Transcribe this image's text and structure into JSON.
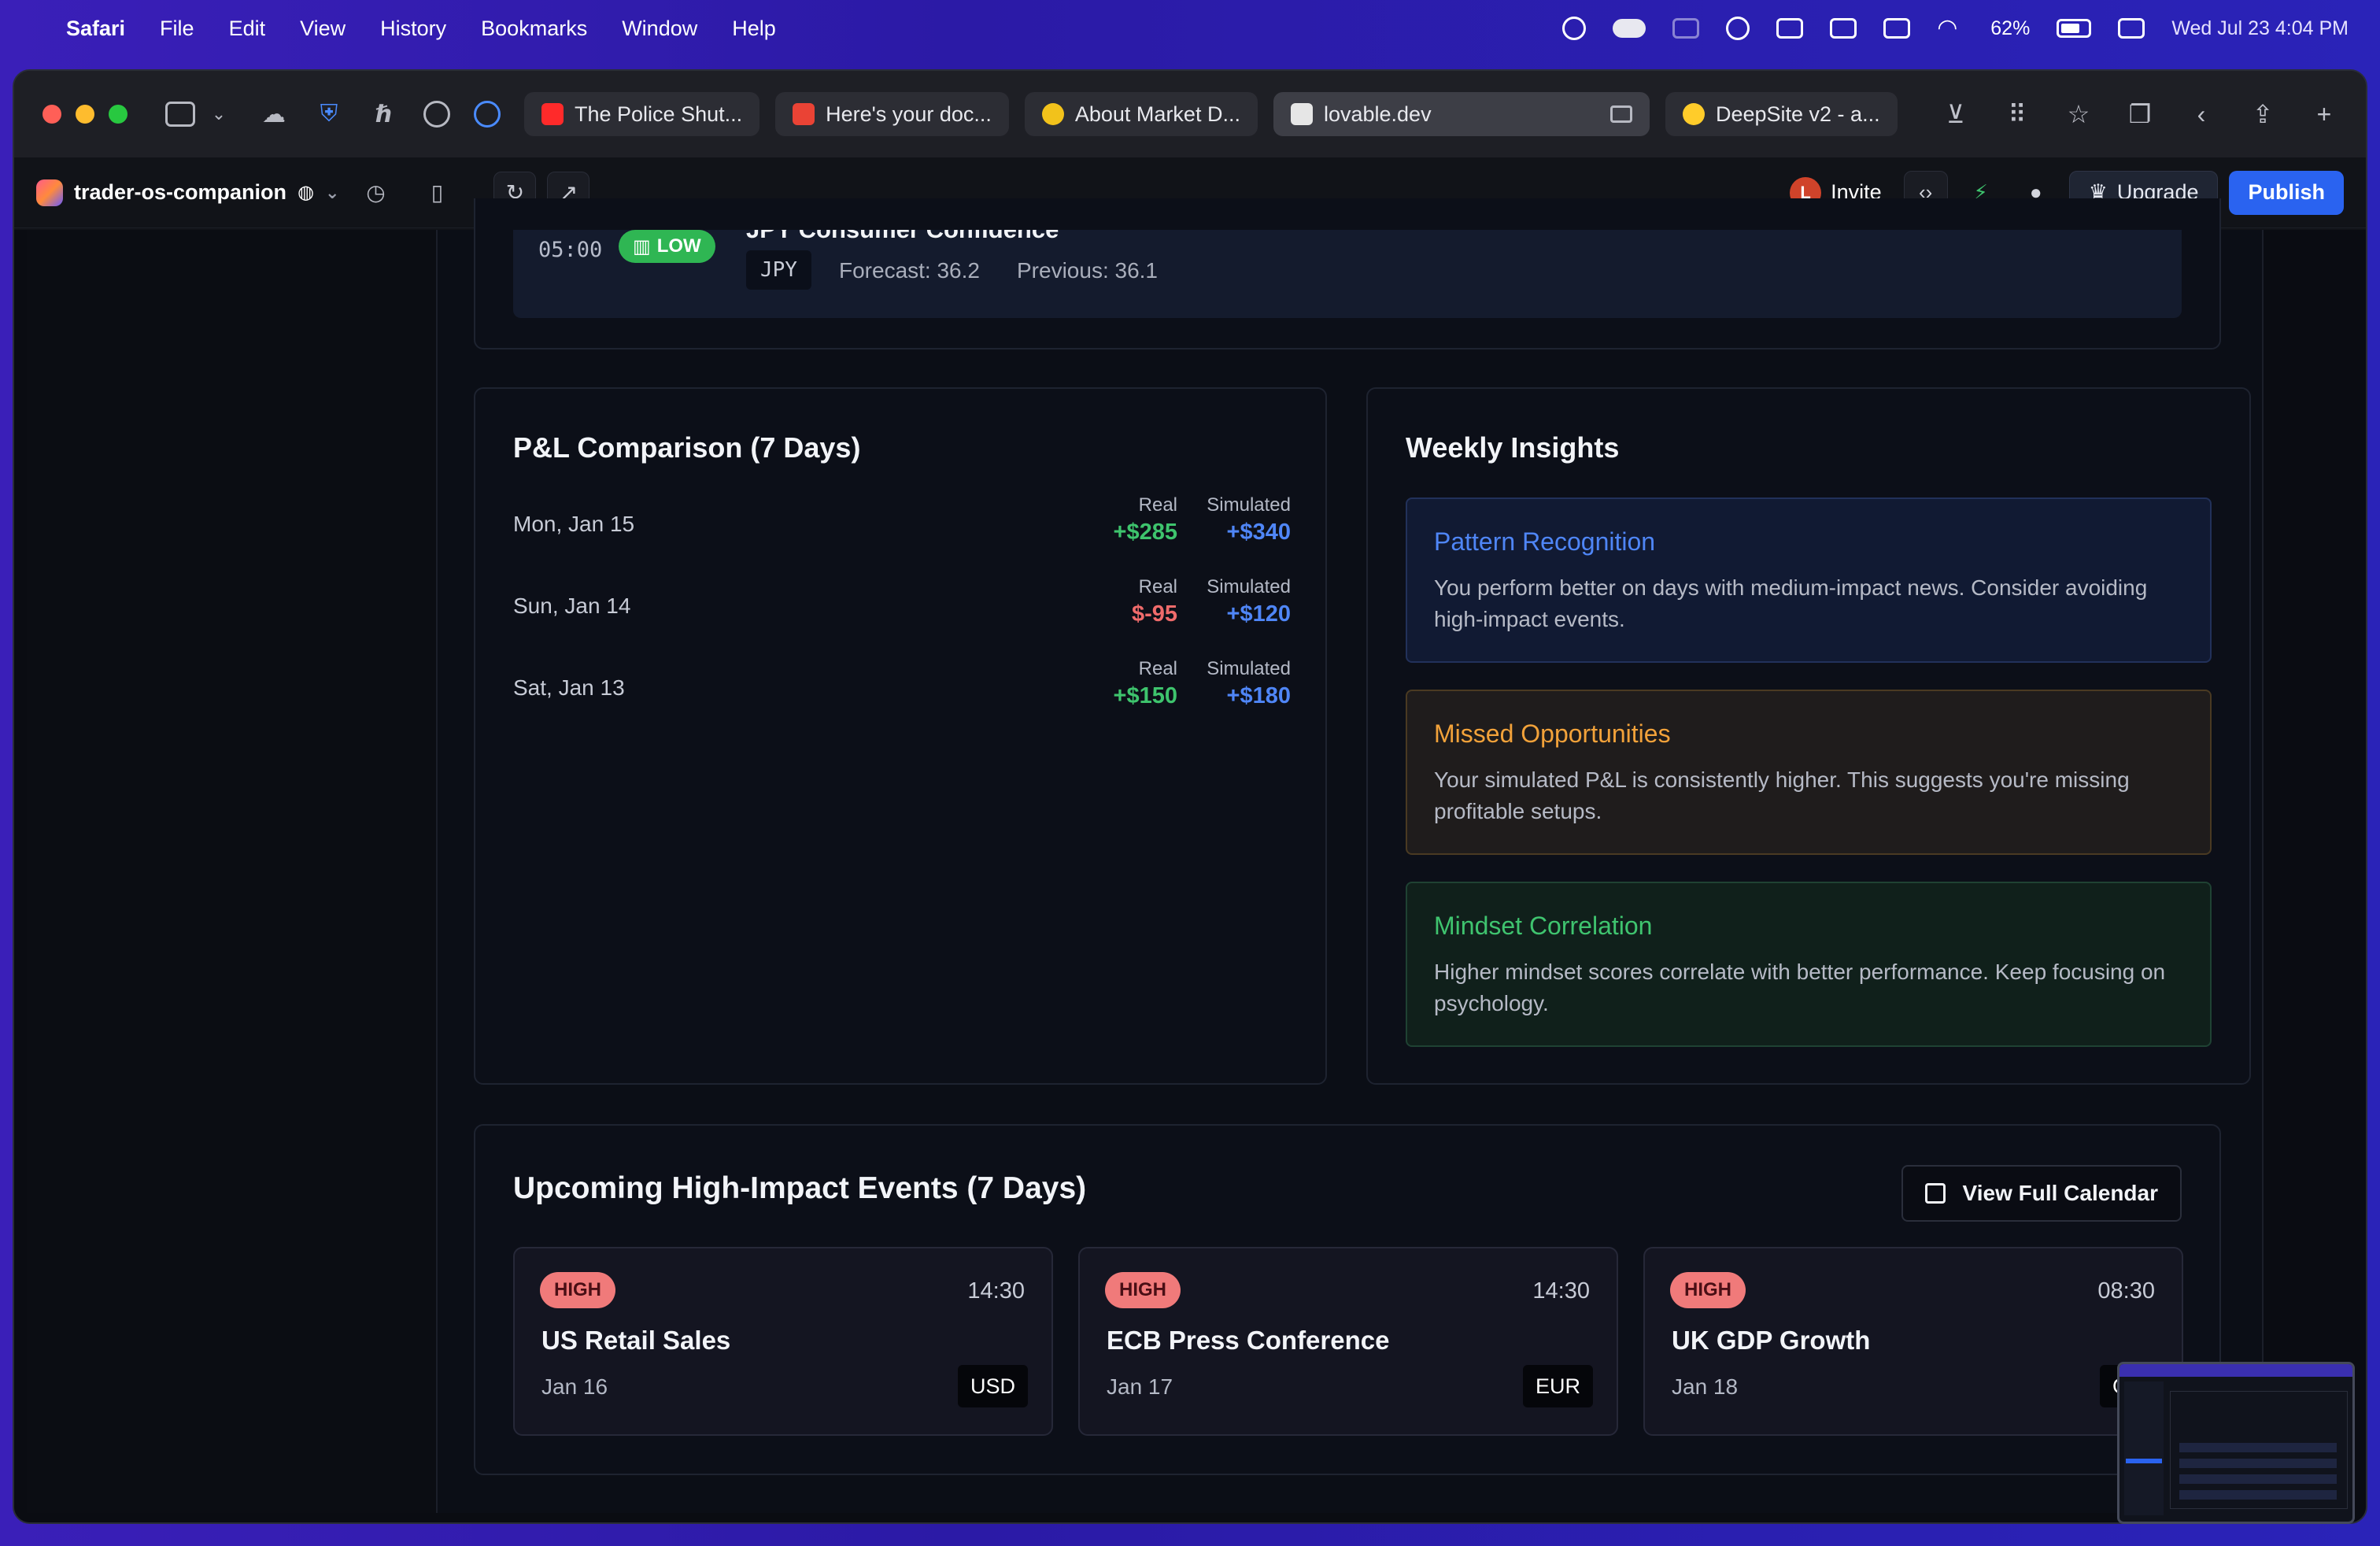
{
  "menubar": {
    "app": "Safari",
    "items": [
      "File",
      "Edit",
      "View",
      "History",
      "Bookmarks",
      "Window",
      "Help"
    ],
    "battery": "62%",
    "datetime": "Wed Jul 23  4:04 PM"
  },
  "tabs": [
    {
      "label": "The Police Shut...",
      "favicon": "youtube-icon",
      "color": "#ff2a2a"
    },
    {
      "label": "Here's your doc...",
      "favicon": "gmail-icon",
      "color": "#ea4335"
    },
    {
      "label": "About Market D...",
      "favicon": "emoji-icon",
      "color": "#f2c21b"
    },
    {
      "label": "lovable.dev",
      "favicon": "lovable-icon",
      "color": "#e6e6e6"
    },
    {
      "label": "DeepSite v2 - a...",
      "favicon": "huggingface-icon",
      "color": "#ffcc2a"
    }
  ],
  "toolbar": {
    "project_name": "trader-os-companion",
    "url_path": "/",
    "invite_label": "Invite",
    "avatar_letter": "L",
    "upgrade_label": "Upgrade",
    "publish_label": "Publish"
  },
  "event_strip": {
    "time": "05:00",
    "impact": "LOW",
    "title": "JPY Consumer Confidence",
    "currency": "JPY",
    "forecast": "Forecast: 36.2",
    "previous": "Previous: 36.1"
  },
  "pl": {
    "title": "P&L Comparison (7 Days)",
    "real_label": "Real",
    "sim_label": "Simulated",
    "rows": [
      {
        "date": "Mon, Jan 15",
        "real": "+$285",
        "sim": "+$340",
        "real_color": "#3ec46d"
      },
      {
        "date": "Sun, Jan 14",
        "real": "$-95",
        "sim": "+$120",
        "real_color": "#ef6b6b"
      },
      {
        "date": "Sat, Jan 13",
        "real": "+$150",
        "sim": "+$180",
        "real_color": "#3ec46d"
      }
    ]
  },
  "insights": {
    "title": "Weekly Insights",
    "items": [
      {
        "title": "Pattern Recognition",
        "text": "You perform better on days with medium-impact news. Consider avoiding high-impact events.",
        "accent": "#4f86f7",
        "bg": "#111a33",
        "border": "#22315a"
      },
      {
        "title": "Missed Opportunities",
        "text": "Your simulated P&L is consistently higher. This suggests you're missing profitable setups.",
        "accent": "#f2a23a",
        "bg": "#1f1c1c",
        "border": "#4a3a22"
      },
      {
        "title": "Mindset Correlation",
        "text": "Higher mindset scores correlate with better performance. Keep focusing on psychology.",
        "accent": "#3fc46f",
        "bg": "#10201b",
        "border": "#1f4233"
      }
    ]
  },
  "events": {
    "title": "Upcoming High-Impact Events (7 Days)",
    "calendar_button": "View Full Calendar",
    "items": [
      {
        "impact": "HIGH",
        "time": "14:30",
        "name": "US Retail Sales",
        "date": "Jan 16",
        "currency": "USD"
      },
      {
        "impact": "HIGH",
        "time": "14:30",
        "name": "ECB Press Conference",
        "date": "Jan 17",
        "currency": "EUR"
      },
      {
        "impact": "HIGH",
        "time": "08:30",
        "name": "UK GDP Growth",
        "date": "Jan 18",
        "currency": "G"
      }
    ]
  }
}
